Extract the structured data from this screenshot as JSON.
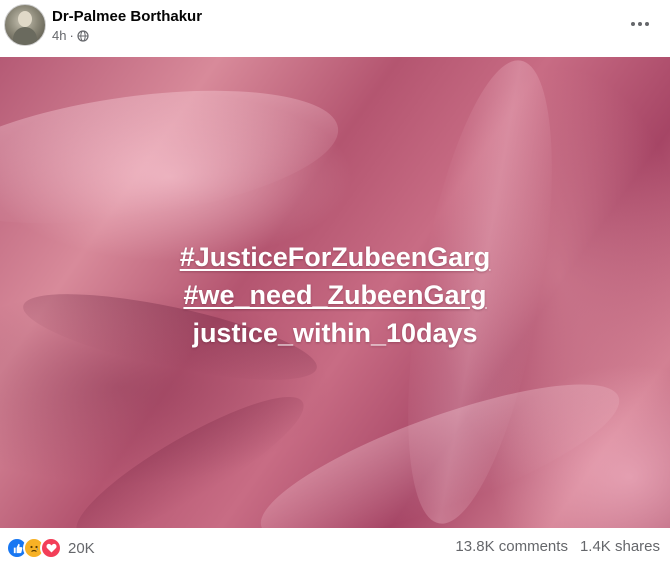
{
  "post": {
    "author": "Dr-Palmee Borthakur",
    "time": "4h",
    "separator": "·",
    "privacy_icon": "globe-icon",
    "more_icon": "more-options-icon"
  },
  "image_text": {
    "line1": "#JusticeForZubeenGarg",
    "line2": "#we_need_ZubeenGarg",
    "line3": "justice_within_10days"
  },
  "footer": {
    "reactions": [
      "like-icon",
      "sad-icon",
      "love-icon"
    ],
    "reaction_count": "20K",
    "comments": "13.8K comments",
    "shares": "1.4K shares"
  },
  "colors": {
    "like": "#1877f2",
    "sad": "#f7b125",
    "love": "#f33e58",
    "secondary_text": "#65676b",
    "background_pink": "#c86c84"
  }
}
